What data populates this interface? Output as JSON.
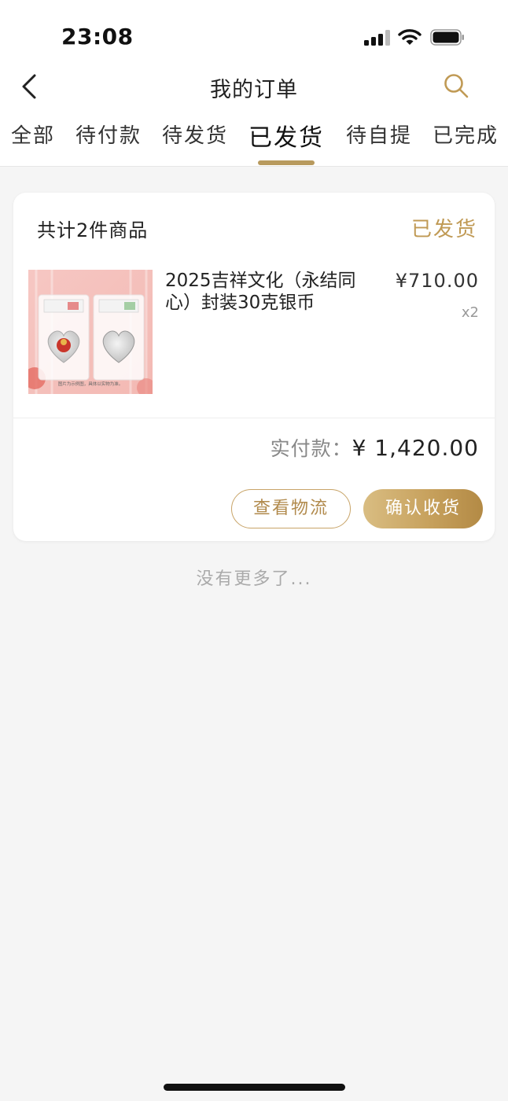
{
  "status_bar": {
    "time": "23:08"
  },
  "header": {
    "title": "我的订单"
  },
  "tabs": [
    {
      "label": "全部"
    },
    {
      "label": "待付款"
    },
    {
      "label": "待发货"
    },
    {
      "label": "已发货"
    },
    {
      "label": "待自提"
    },
    {
      "label": "已完成"
    }
  ],
  "active_tab": "已发货",
  "order": {
    "count_text": "共计2件商品",
    "status": "已发货",
    "product": {
      "name": "2025吉祥文化（永结同心）封装30克银币",
      "price": "¥710.00",
      "quantity": "x2",
      "image_caption": "图片为示例图，具体以实物为准。"
    },
    "paid_label": "实付款：",
    "paid_amount": "¥ 1,420.00",
    "buttons": {
      "logistics": "查看物流",
      "confirm": "确认收货"
    }
  },
  "footer_text": "没有更多了...",
  "colors": {
    "accent": "#c09a55",
    "background": "#f5f5f5"
  },
  "icons": [
    "back-icon",
    "search-icon",
    "signal-icon",
    "wifi-icon",
    "battery-icon"
  ]
}
